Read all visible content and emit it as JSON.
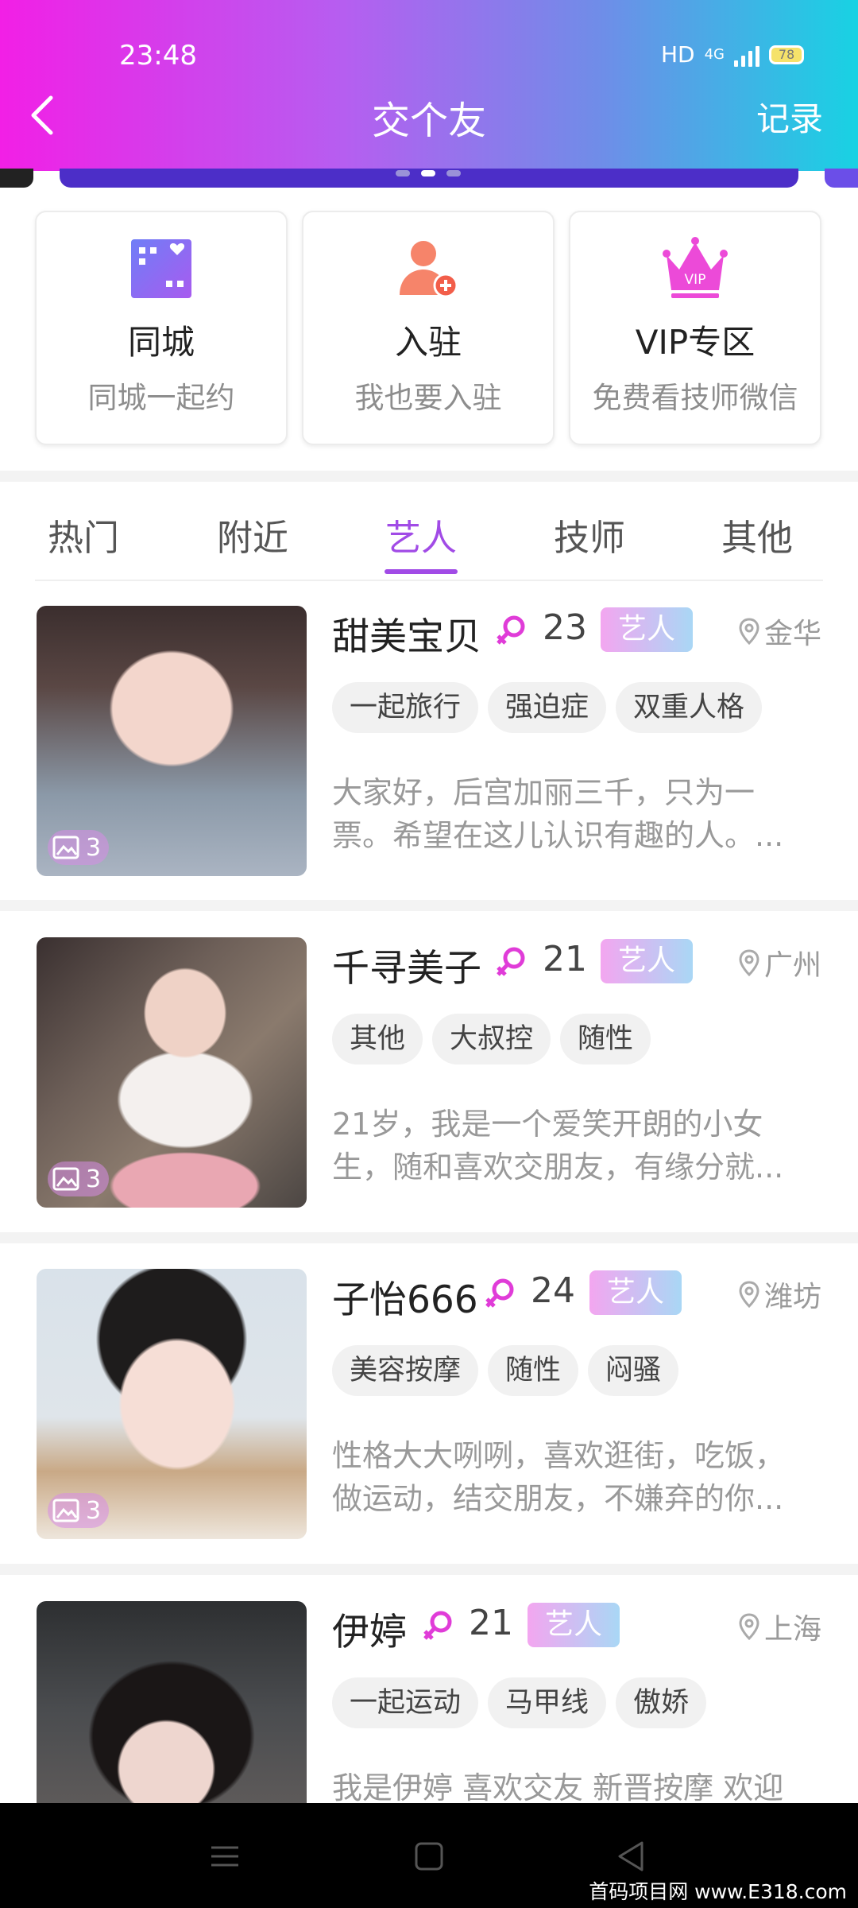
{
  "status_bar": {
    "time": "23:48",
    "network": "HD",
    "signal": "4G",
    "battery": "78"
  },
  "header": {
    "title": "交个友",
    "right_action": "记录"
  },
  "feature_cards": [
    {
      "title": "同城",
      "subtitle": "同城一起约",
      "icon": "city-icon"
    },
    {
      "title": "入驻",
      "subtitle": "我也要入驻",
      "icon": "add-user-icon"
    },
    {
      "title": "VIP专区",
      "subtitle": "免费看技师微信",
      "icon": "vip-crown-icon"
    }
  ],
  "tabs": [
    {
      "label": "热门"
    },
    {
      "label": "附近"
    },
    {
      "label": "艺人",
      "active": true
    },
    {
      "label": "技师"
    },
    {
      "label": "其他"
    }
  ],
  "profiles": [
    {
      "name": "甜美宝贝",
      "age": "23",
      "badge": "艺人",
      "location": "金华",
      "photo_count": "3",
      "tags": [
        "一起旅行",
        "强迫症",
        "双重人格"
      ],
      "description": "大家好，后宫加丽三千，只为一票。希望在这儿认识有趣的人。..."
    },
    {
      "name": "千寻美子",
      "age": "21",
      "badge": "艺人",
      "location": "广州",
      "photo_count": "3",
      "tags": [
        "其他",
        "大叔控",
        "随性"
      ],
      "description": "21岁，我是一个爱笑开朗的小女生，随和喜欢交朋友，有缘分就..."
    },
    {
      "name": "子怡666",
      "age": "24",
      "badge": "艺人",
      "location": "潍坊",
      "photo_count": "3",
      "tags": [
        "美容按摩",
        "随性",
        "闷骚"
      ],
      "description": "性格大大咧咧，喜欢逛街，吃饭，做运动，结交朋友，不嫌弃的你..."
    },
    {
      "name": "伊婷",
      "age": "21",
      "badge": "艺人",
      "location": "上海",
      "photo_count": "",
      "tags": [
        "一起运动",
        "马甲线",
        "傲娇"
      ],
      "description": "我是伊婷 喜欢交友 新晋按摩 欢迎"
    }
  ],
  "watermark": "首码项目网 www.E318.com",
  "colors": {
    "accent": "#a14be6",
    "gender": "#e03cd8"
  }
}
